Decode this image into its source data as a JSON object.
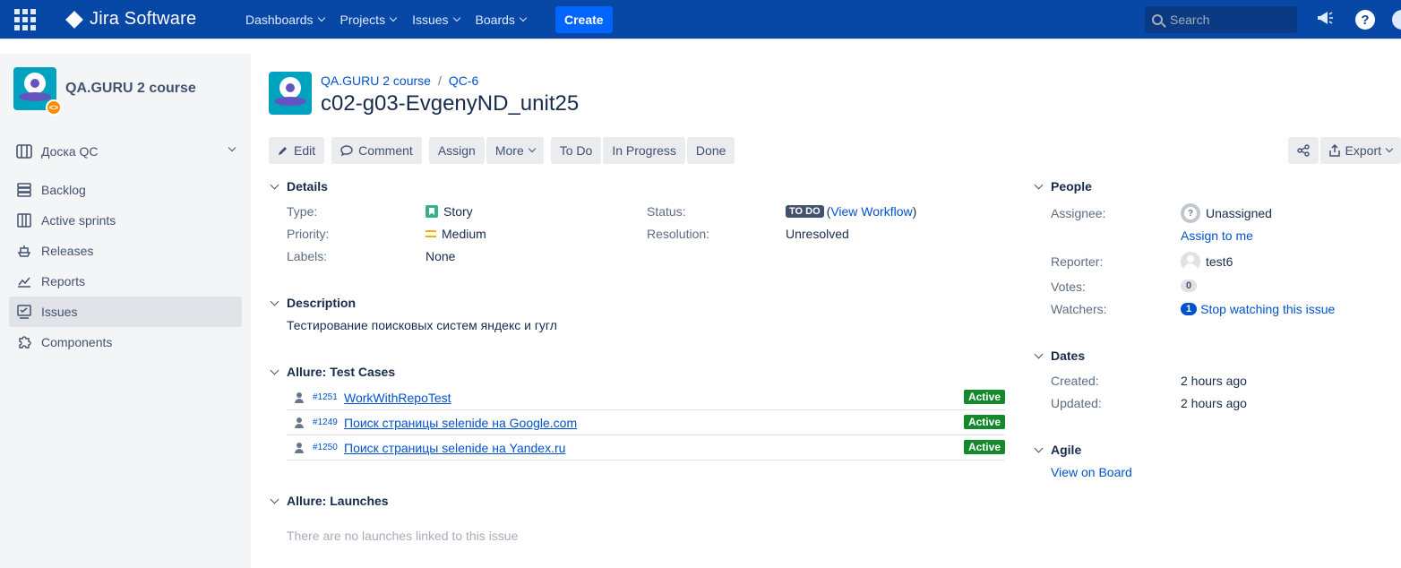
{
  "topnav": {
    "product": "Jira Software",
    "menus": [
      "Dashboards",
      "Projects",
      "Issues",
      "Boards"
    ],
    "create": "Create",
    "search_placeholder": "Search",
    "help": "?"
  },
  "sidebar": {
    "project_name": "QA.GURU 2 course",
    "board": "Доска QC",
    "items": [
      "Backlog",
      "Active sprints",
      "Releases",
      "Reports",
      "Issues",
      "Components"
    ],
    "active_item": "Issues"
  },
  "issue": {
    "breadcrumb": [
      "QA.GURU 2 course",
      "QC-6"
    ],
    "summary": "c02-g03-EvgenyND_unit25",
    "toolbar": {
      "edit": "Edit",
      "comment": "Comment",
      "assign": "Assign",
      "more": "More",
      "todo": "To Do",
      "in_progress": "In Progress",
      "done": "Done",
      "export": "Export"
    },
    "details": {
      "title": "Details",
      "type_label": "Type:",
      "type_value": "Story",
      "priority_label": "Priority:",
      "priority_value": "Medium",
      "labels_label": "Labels:",
      "labels_value": "None",
      "status_label": "Status:",
      "status_value": "TO DO",
      "workflow_link": "View Workflow",
      "resolution_label": "Resolution:",
      "resolution_value": "Unresolved"
    },
    "description": {
      "title": "Description",
      "text": "Тестирование поисковых систем яндекс и гугл"
    },
    "test_cases": {
      "title": "Allure: Test Cases",
      "rows": [
        {
          "id": "#1251",
          "name": "WorkWithRepoTest",
          "status": "Active"
        },
        {
          "id": "#1249",
          "name": "Поиск страницы selenide на Google.com",
          "status": "Active"
        },
        {
          "id": "#1250",
          "name": "Поиск страницы selenide на Yandex.ru",
          "status": "Active"
        }
      ]
    },
    "launches": {
      "title": "Allure: Launches",
      "empty": "There are no launches linked to this issue"
    },
    "people": {
      "title": "People",
      "assignee_label": "Assignee:",
      "assignee_value": "Unassigned",
      "assign_to_me": "Assign to me",
      "reporter_label": "Reporter:",
      "reporter_value": "test6",
      "votes_label": "Votes:",
      "votes_value": "0",
      "watchers_label": "Watchers:",
      "watchers_count": "1",
      "watchers_link": "Stop watching this issue"
    },
    "dates": {
      "title": "Dates",
      "created_label": "Created:",
      "created_value": "2 hours ago",
      "updated_label": "Updated:",
      "updated_value": "2 hours ago"
    },
    "agile": {
      "title": "Agile",
      "link": "View on Board"
    }
  }
}
